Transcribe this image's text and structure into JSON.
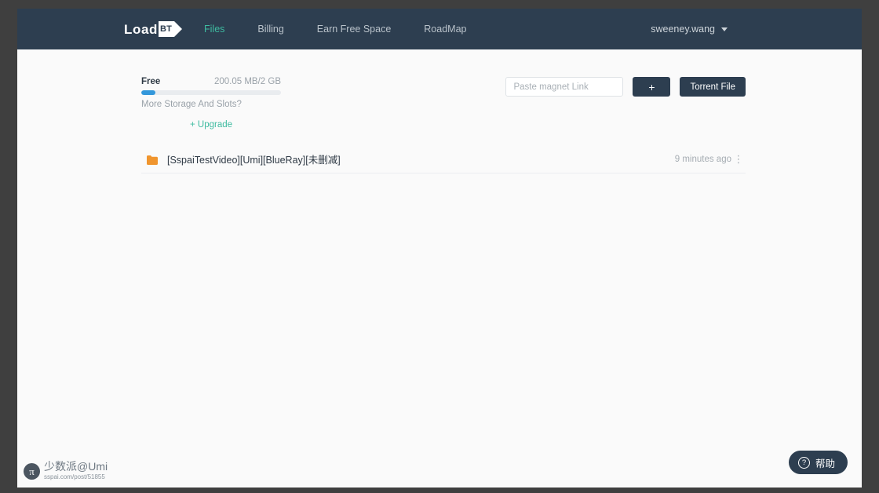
{
  "brand": {
    "name": "Load",
    "mark_label": "BT",
    "mark_icon": "play-triangle-icon"
  },
  "nav": {
    "links": [
      {
        "label": "Files",
        "active": true
      },
      {
        "label": "Billing",
        "active": false
      },
      {
        "label": "Earn Free Space",
        "active": false
      },
      {
        "label": "RoadMap",
        "active": false
      }
    ],
    "account": {
      "username": "sweeney.wang",
      "caret_icon": "chevron-down-icon"
    }
  },
  "storage": {
    "plan_label": "Free",
    "usage_text": "200.05 MB/2 GB",
    "used": "200.05 MB",
    "total": "2 GB",
    "percent": 10,
    "prompt": "More Storage And Slots?",
    "upgrade_label": "+ Upgrade"
  },
  "actions": {
    "magnet_placeholder": "Paste magnet Link",
    "magnet_value": "",
    "add_label": "+",
    "torrent_label": "Torrent File"
  },
  "files": {
    "rows": [
      {
        "icon": "folder-icon",
        "name": "[SspaiTestVideo][Umi][BlueRay][未删减]",
        "time": "9 minutes ago",
        "menu_icon": "kebab-menu-icon"
      }
    ]
  },
  "help": {
    "icon": "question-mark-icon",
    "label": "帮助"
  },
  "watermark": {
    "badge": "π",
    "title": "少数派@Umi",
    "url": "sspai.com/post/51855"
  },
  "colors": {
    "navbar": "#2d3e50",
    "accent_teal": "#3ebba0",
    "progress_blue": "#3498db",
    "folder_orange": "#f0952e",
    "page_bg": "#fafafa",
    "frame": "#3f3f3f"
  }
}
